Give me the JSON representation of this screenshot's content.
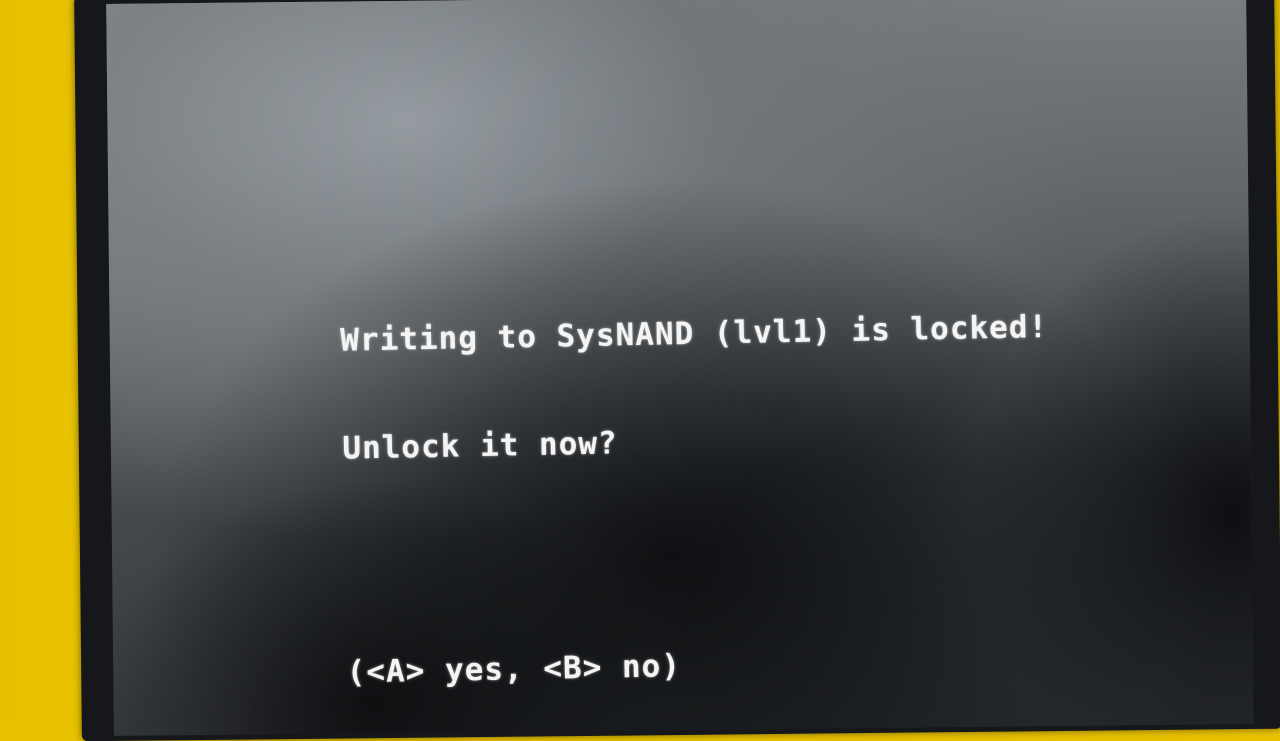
{
  "dialog": {
    "message_line_1": "Writing to SysNAND (lvl1) is locked!",
    "message_line_2": "Unlock it now?",
    "prompt_open": "(",
    "option_yes": "<A> yes",
    "separator": ", ",
    "option_no": "<B> no",
    "prompt_close": ")"
  }
}
